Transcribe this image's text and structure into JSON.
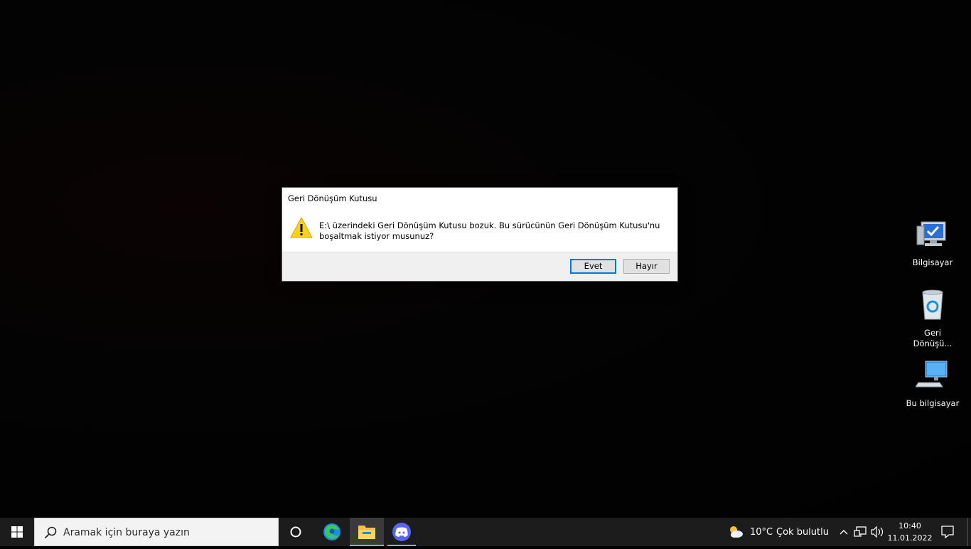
{
  "dialog": {
    "title": "Geri Dönüşüm Kutusu",
    "message_line1": "E:\\ üzerindeki Geri Dönüşüm Kutusu bozuk.  Bu sürücünün Geri Dönüşüm Kutusu'nu",
    "message_line2": "boşaltmak istiyor musunuz?",
    "yes_label": "Evet",
    "no_label": "Hayır",
    "icon": "warning-icon"
  },
  "desktop_icons": [
    {
      "label": "Bilgisayar",
      "icon": "computer-check-icon"
    },
    {
      "label_line1": "Geri",
      "label_line2": "Dönüşü...",
      "icon": "recycle-bin-icon"
    },
    {
      "label": "Bu bilgisayar",
      "icon": "this-pc-icon"
    }
  ],
  "taskbar": {
    "search_placeholder": "Aramak için buraya yazın",
    "apps": [
      "cortana-icon",
      "edge-icon",
      "file-explorer-icon",
      "discord-icon"
    ],
    "weather_temp": "10°C",
    "weather_desc": "Çok bulutlu",
    "time": "10:40",
    "date": "11.01.2022"
  },
  "colors": {
    "accent": "#0078d7",
    "taskbar": "#1c1c1c",
    "dialog_footer": "#f0f0f0"
  }
}
